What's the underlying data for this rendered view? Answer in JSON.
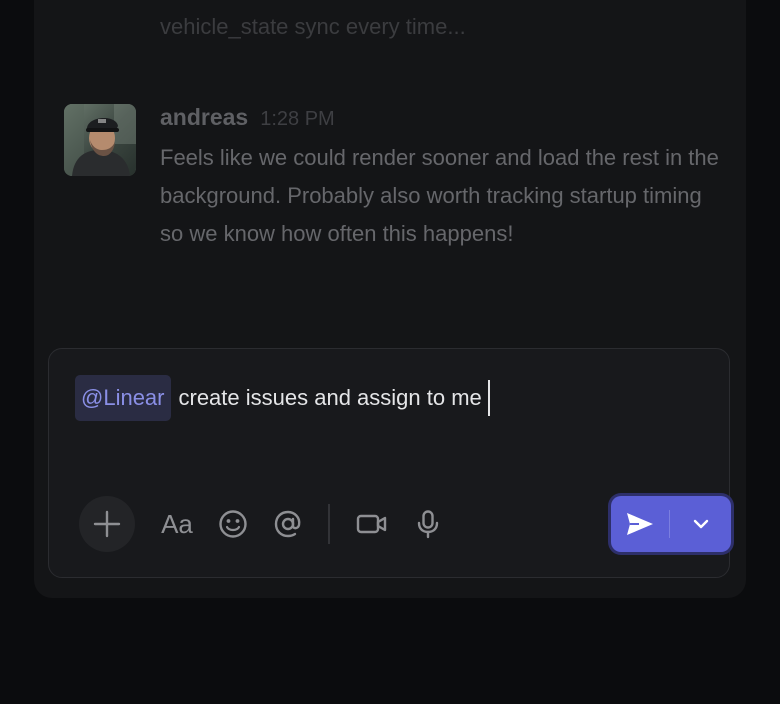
{
  "thread": {
    "previous_message_fragment": "vehicle_state sync every time..."
  },
  "message": {
    "author": "andreas",
    "time": "1:28 PM",
    "text": "Feels like we could render sooner and load the rest in the background. Probably also worth tracking startup timing so we know how often this happens!",
    "avatar_icon": "user-photo-avatar"
  },
  "composer": {
    "mention": "@Linear",
    "input_text": "create issues and assign to me",
    "toolbar": {
      "add_icon": "plus-icon",
      "format_label": "Aa",
      "emoji_icon": "smiley-icon",
      "mention_icon": "at-sign-icon",
      "video_icon": "video-camera-icon",
      "audio_icon": "microphone-icon",
      "send_icon": "paper-plane-icon",
      "send_options_icon": "chevron-down-icon"
    }
  },
  "colors": {
    "accent": "#5b5fd6",
    "mention_text": "#8a8fe6",
    "background": "#0b0c0e"
  }
}
